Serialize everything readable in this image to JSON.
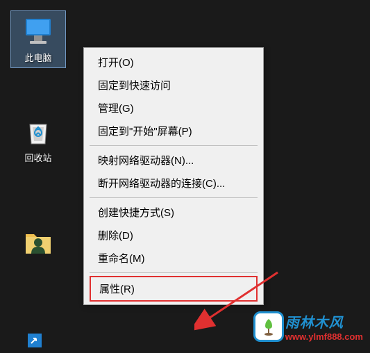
{
  "desktop": {
    "icons": {
      "this_pc": "此电脑",
      "recycle_bin": "回收站",
      "folder": ""
    }
  },
  "context_menu": {
    "groups": [
      [
        "打开(O)",
        "固定到快速访问",
        "管理(G)",
        "固定到\"开始\"屏幕(P)"
      ],
      [
        "映射网络驱动器(N)...",
        "断开网络驱动器的连接(C)..."
      ],
      [
        "创建快捷方式(S)",
        "删除(D)",
        "重命名(M)"
      ],
      [
        "属性(R)"
      ]
    ]
  },
  "watermark": {
    "title": "雨林木风",
    "url": "www.ylmf888.com"
  }
}
